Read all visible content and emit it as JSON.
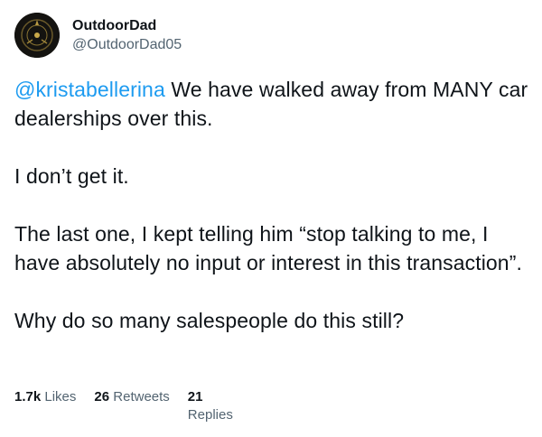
{
  "author": {
    "display_name": "OutdoorDad",
    "handle": "@OutdoorDad05",
    "avatar_icon": "profile-avatar"
  },
  "tweet": {
    "mention": "@kristabellerina",
    "line1_rest": " We have walked away from MANY car dealerships over this.",
    "para2": "I don’t get it.",
    "para3": "The last one, I kept telling him “stop talking to me, I have absolutely no input or interest in this transaction”.",
    "para4": "Why do so many salespeople do this still?"
  },
  "stats": {
    "likes_count": "1.7k",
    "likes_label": "Likes",
    "retweets_count": "26",
    "retweets_label": "Retweets",
    "replies_count": "21",
    "replies_label": "Replies"
  },
  "colors": {
    "mention": "#1d9bf0",
    "secondary_text": "#536471"
  }
}
